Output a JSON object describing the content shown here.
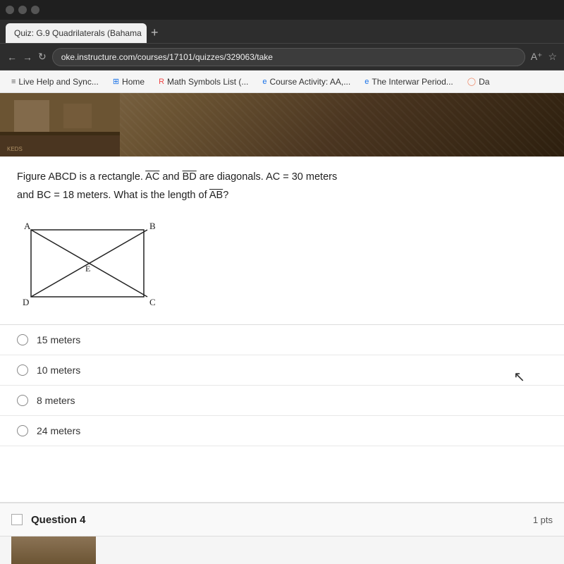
{
  "window": {
    "title": "Quiz: G.9 Quadrilaterals (Bahama",
    "tab_label": "Quiz: G.9 Quadrilaterals (Bahama",
    "new_tab": "+",
    "address": "oke.instructure.com/courses/17101/quizzes/329063/take"
  },
  "bookmarks": [
    {
      "id": "live-help",
      "label": "Live Help and Sync...",
      "icon": "≡"
    },
    {
      "id": "home",
      "label": "Home",
      "icon": "⊞"
    },
    {
      "id": "math-symbols",
      "label": "Math Symbols List (...",
      "icon": "R"
    },
    {
      "id": "course-activity",
      "label": "Course Activity: AA,...",
      "icon": "e"
    },
    {
      "id": "interwar",
      "label": "The Interwar Period...",
      "icon": "e"
    },
    {
      "id": "da",
      "label": "Da",
      "icon": "◯"
    }
  ],
  "question": {
    "text_parts": [
      "Figure ABCD is a rectangle. ",
      "AC",
      " and ",
      "BD",
      " are diagonals.  AC = 30 meters",
      "and BC = 18 meters.  What is the length of ",
      "AB",
      "?"
    ],
    "diagram": {
      "vertices": {
        "A": "top-left",
        "B": "top-right",
        "D": "bottom-left",
        "C": "bottom-right",
        "E": "center"
      }
    },
    "options": [
      {
        "id": "opt1",
        "label": "15 meters"
      },
      {
        "id": "opt2",
        "label": "10 meters"
      },
      {
        "id": "opt3",
        "label": "8 meters"
      },
      {
        "id": "opt4",
        "label": "24 meters"
      }
    ]
  },
  "question4": {
    "title": "Question 4",
    "pts": "1 pts"
  }
}
